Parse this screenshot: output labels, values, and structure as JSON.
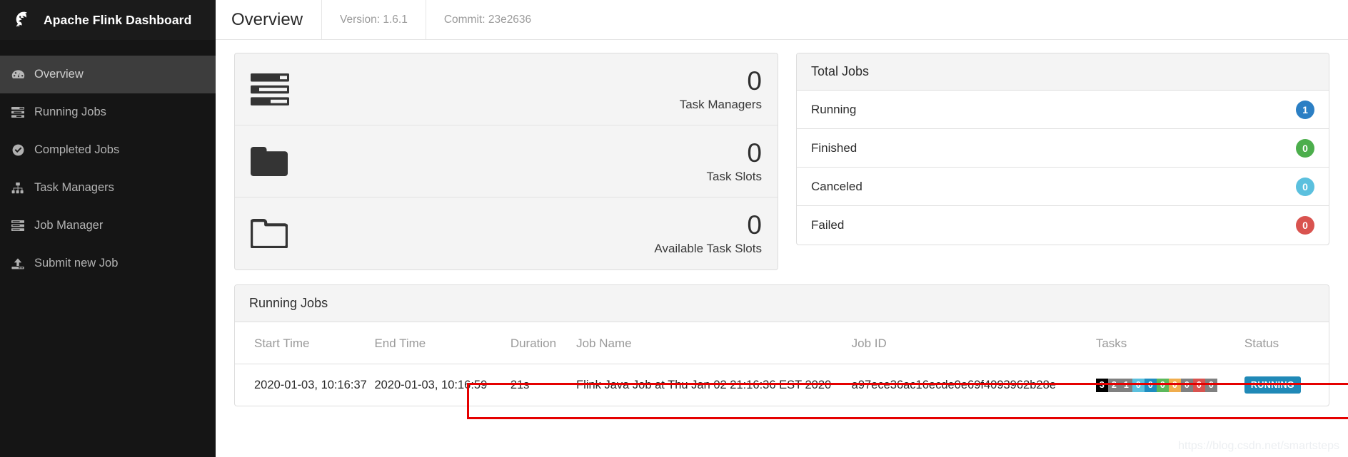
{
  "app": {
    "title": "Apache Flink Dashboard",
    "logo_icon": "flink-squirrel-logo"
  },
  "sidebar": {
    "items": [
      {
        "label": "Overview",
        "icon": "dashboard-icon",
        "active": true
      },
      {
        "label": "Running Jobs",
        "icon": "tasks-list-icon",
        "active": false
      },
      {
        "label": "Completed Jobs",
        "icon": "check-circle-icon",
        "active": false
      },
      {
        "label": "Task Managers",
        "icon": "sitemap-icon",
        "active": false
      },
      {
        "label": "Job Manager",
        "icon": "server-icon",
        "active": false
      },
      {
        "label": "Submit new Job",
        "icon": "upload-icon",
        "active": false
      }
    ]
  },
  "topbar": {
    "page_title": "Overview",
    "version": "Version: 1.6.1",
    "commit": "Commit: 23e2636"
  },
  "stats": [
    {
      "value": "0",
      "label": "Task Managers",
      "icon": "task-manager-bars-icon"
    },
    {
      "value": "0",
      "label": "Task Slots",
      "icon": "folder-filled-icon"
    },
    {
      "value": "0",
      "label": "Available Task Slots",
      "icon": "folder-outline-icon"
    }
  ],
  "total_jobs": {
    "title": "Total Jobs",
    "rows": [
      {
        "label": "Running",
        "count": "1",
        "color": "#2b7fc4"
      },
      {
        "label": "Finished",
        "count": "0",
        "color": "#4cae4c"
      },
      {
        "label": "Canceled",
        "count": "0",
        "color": "#5bc0de"
      },
      {
        "label": "Failed",
        "count": "0",
        "color": "#d9534f"
      }
    ]
  },
  "running_jobs": {
    "title": "Running Jobs",
    "columns": {
      "start_time": "Start Time",
      "end_time": "End Time",
      "duration": "Duration",
      "job_name": "Job Name",
      "job_id": "Job ID",
      "tasks": "Tasks",
      "status": "Status"
    },
    "rows": [
      {
        "start_time": "2020-01-03, 10:16:37",
        "end_time": "2020-01-03, 10:16:59",
        "duration": "21s",
        "job_name": "Flink Java Job at Thu Jan 02 21:16:36 EST 2020",
        "job_id": "a97ece36ac16ecde0e69f4093962b28e",
        "tasks": [
          {
            "value": "3",
            "color": "#000000"
          },
          {
            "value": "2",
            "color": "#808080"
          },
          {
            "value": "1",
            "color": "#808080"
          },
          {
            "value": "0",
            "color": "#5bc0de"
          },
          {
            "value": "0",
            "color": "#1f8dc0"
          },
          {
            "value": "0",
            "color": "#5cb85c"
          },
          {
            "value": "0",
            "color": "#f0ad4e"
          },
          {
            "value": "0",
            "color": "#808080"
          },
          {
            "value": "0",
            "color": "#d9534f"
          },
          {
            "value": "0",
            "color": "#808080"
          }
        ],
        "status": "RUNNING",
        "status_color": "#2089b7"
      }
    ]
  },
  "watermark": "https://blog.csdn.net/smartsteps"
}
